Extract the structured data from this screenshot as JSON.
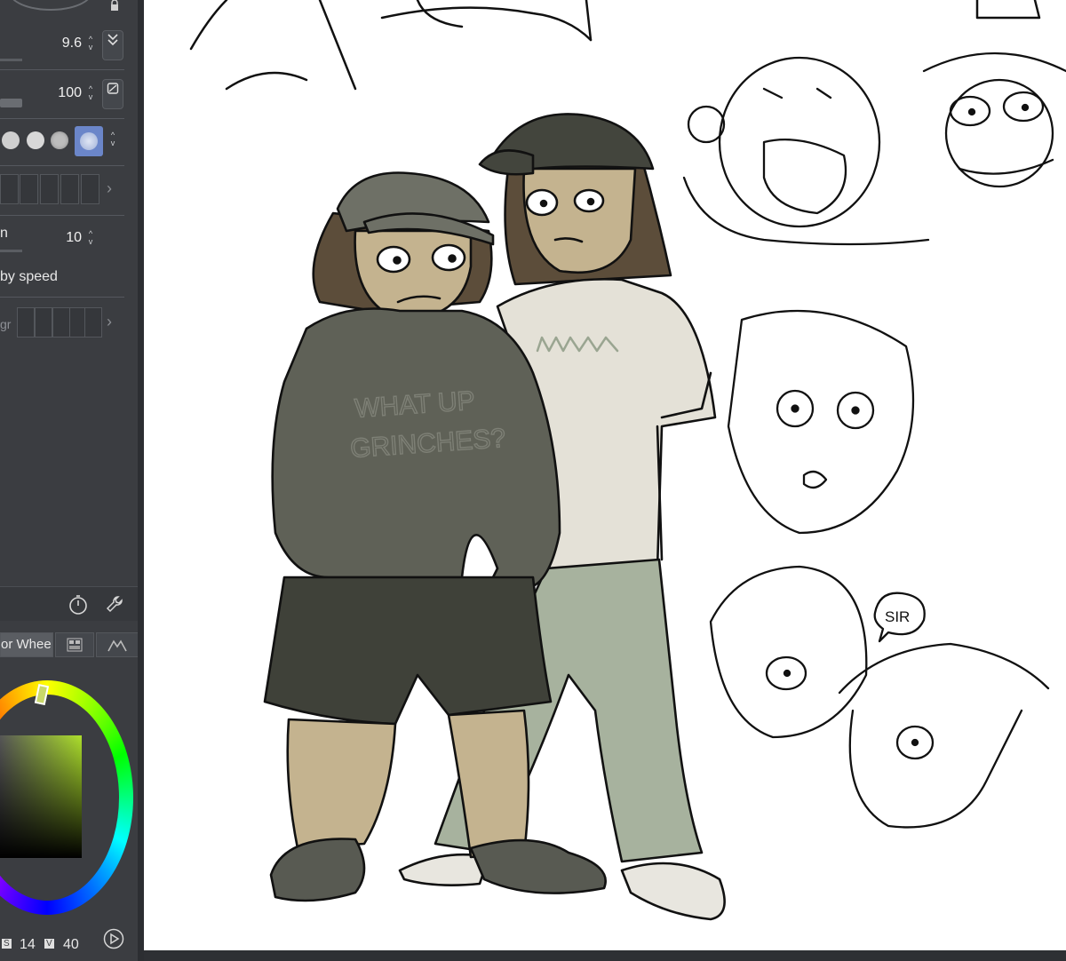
{
  "brush_panel": {
    "size_value": "9.6",
    "opacity_value": "100",
    "stabilization_label": "n",
    "stabilization_value": "10",
    "speed_label": "by speed",
    "partial_label": "gr"
  },
  "color_panel": {
    "tab_label": "or Whee",
    "footer_s_badge": "S",
    "footer_s_value": "14",
    "footer_v_badge": "V",
    "footer_v_value": "40"
  },
  "canvas": {
    "hoodie_text_line1": "WHAT UP",
    "hoodie_text_line2": "GRINCHES?",
    "speech_bubble_text": "SIR"
  },
  "icons": {
    "stepper": "stepper-icon",
    "pressure": "pressure-icon",
    "opacity_toggle": "opacity-toggle-icon",
    "timer": "timer-icon",
    "wrench": "wrench-icon",
    "play": "play-icon"
  },
  "colors": {
    "panel_bg": "#3b3d41",
    "canvas_bg": "#ffffff",
    "hoodie": "#5f6157",
    "shirt": "#e4e1d7",
    "pants": "#a7b29e",
    "skin": "#c4b38f",
    "current_color_light": "#aee02c"
  }
}
